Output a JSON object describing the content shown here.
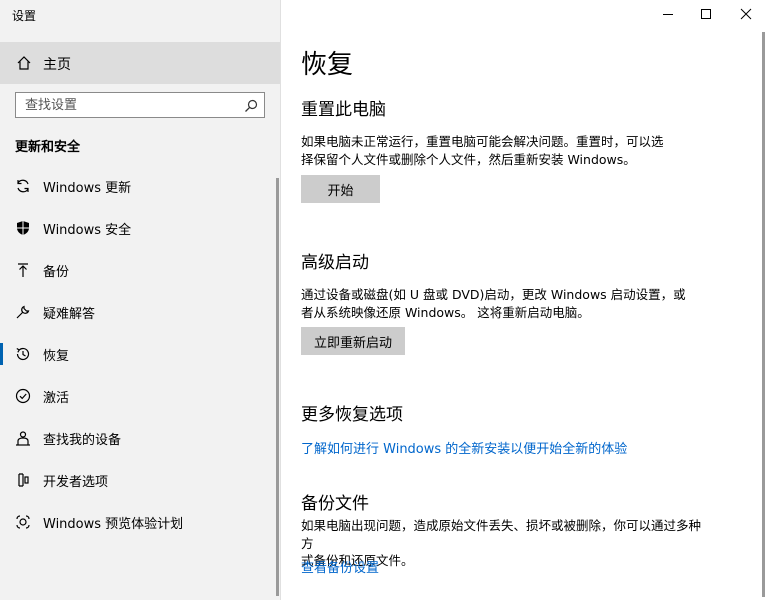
{
  "window": {
    "title": "设置"
  },
  "sidebar": {
    "home_label": "主页",
    "search_placeholder": "查找设置",
    "section_title": "更新和安全",
    "items": [
      {
        "label": "Windows 更新",
        "icon": "sync-icon"
      },
      {
        "label": "Windows 安全",
        "icon": "shield-icon"
      },
      {
        "label": "备份",
        "icon": "upload-icon"
      },
      {
        "label": "疑难解答",
        "icon": "wrench-icon"
      },
      {
        "label": "恢复",
        "icon": "history-icon",
        "active": true
      },
      {
        "label": "激活",
        "icon": "check-circle-icon"
      },
      {
        "label": "查找我的设备",
        "icon": "person-pin-icon"
      },
      {
        "label": "开发者选项",
        "icon": "developer-icon"
      },
      {
        "label": "Windows 预览体验计划",
        "icon": "insider-icon"
      }
    ]
  },
  "main": {
    "title": "恢复",
    "reset": {
      "heading": "重置此电脑",
      "desc_line1": "如果电脑未正常运行，重置电脑可能会解决问题。重置时，可以选",
      "desc_line2": "择保留个人文件或删除个人文件，然后重新安装 Windows。",
      "button": "开始"
    },
    "advanced": {
      "heading": "高级启动",
      "desc_line1": "通过设备或磁盘(如 U 盘或 DVD)启动，更改 Windows 启动设置，或",
      "desc_line2": "者从系统映像还原 Windows。 这将重新启动电脑。",
      "button": "立即重新启动"
    },
    "more": {
      "heading": "更多恢复选项",
      "link": "了解如何进行 Windows 的全新安装以便开始全新的体验"
    },
    "backup": {
      "heading": "备份文件",
      "desc_line1": "如果电脑出现问题，造成原始文件丢失、损坏或被删除，你可以通过多种方",
      "desc_line2": "式备份和还原文件。",
      "link": "查看备份设置"
    }
  },
  "colors": {
    "accent": "#0063b1",
    "link": "#0066cc",
    "sidebar_bg": "#f2f2f2",
    "button_bg": "#cccccc"
  }
}
